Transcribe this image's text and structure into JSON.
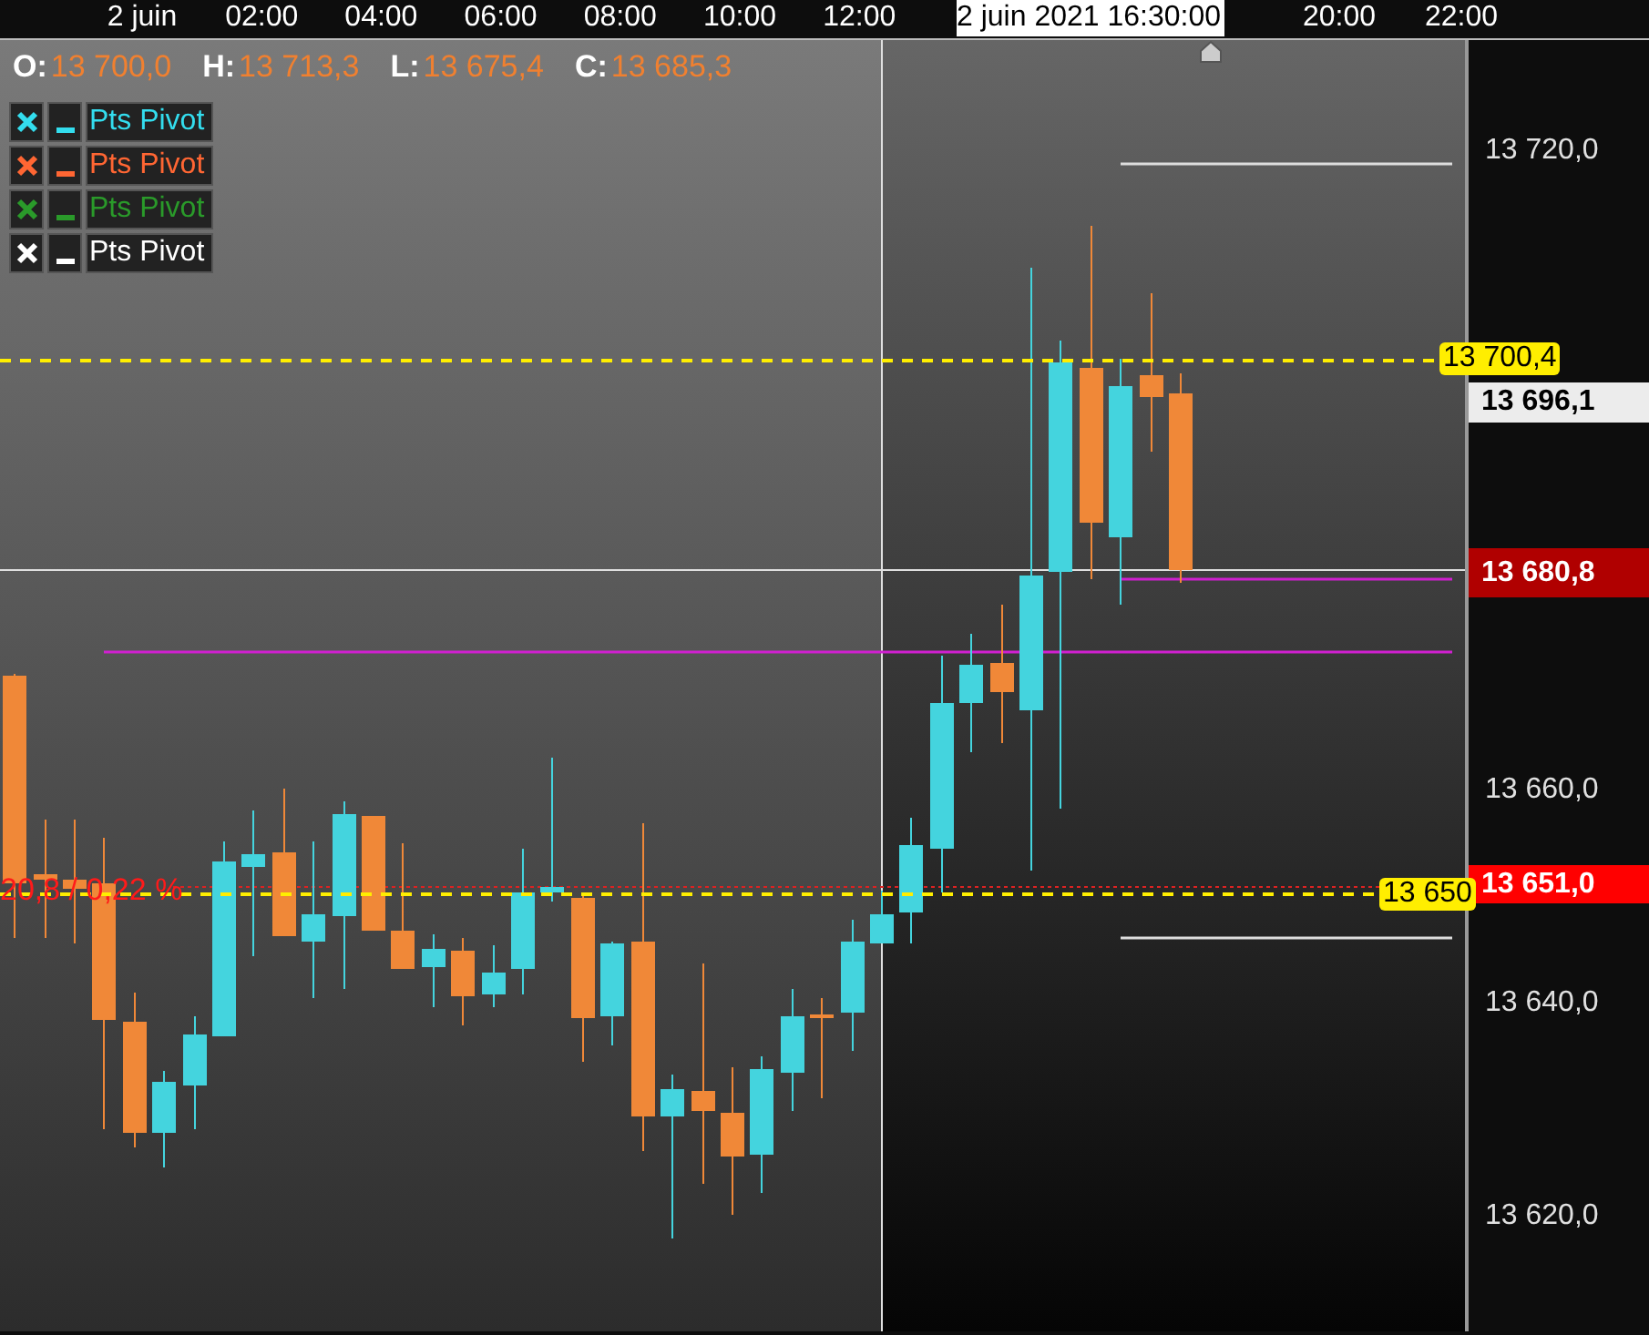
{
  "time_axis": {
    "labels": [
      "2 juin",
      "02:00",
      "04:00",
      "06:00",
      "08:00",
      "10:00",
      "12:00"
    ],
    "labels_right": [
      "20:00",
      "22:00"
    ],
    "cursor_time": "2 juin 2021 16:30:00"
  },
  "ohlc": [
    {
      "key": "O:",
      "value": "13 700,0"
    },
    {
      "key": "H:",
      "value": "13 713,3"
    },
    {
      "key": "L:",
      "value": "13 675,4"
    },
    {
      "key": "C:",
      "value": "13 685,3"
    }
  ],
  "legend": [
    {
      "label": "Pts Pivot",
      "color": "#33ddee"
    },
    {
      "label": "Pts Pivot",
      "color": "#ff6633"
    },
    {
      "label": "Pts Pivot",
      "color": "#2a9a2a"
    },
    {
      "label": "Pts Pivot",
      "color": "#ffffff"
    }
  ],
  "measure_text": "20,8 / 0,22 %",
  "line_labels": [
    {
      "text": "13 700,4"
    },
    {
      "text": "13 650"
    }
  ],
  "price_axis": {
    "ticks": [
      "13 720,0",
      "13 660,0",
      "13 640,0",
      "13 620,0"
    ],
    "markers": [
      {
        "text": "13 696,1",
        "kind": "cursor"
      },
      {
        "text": "13 680,8",
        "kind": "last"
      },
      {
        "text": "13 651,0",
        "kind": "alert"
      }
    ]
  }
}
